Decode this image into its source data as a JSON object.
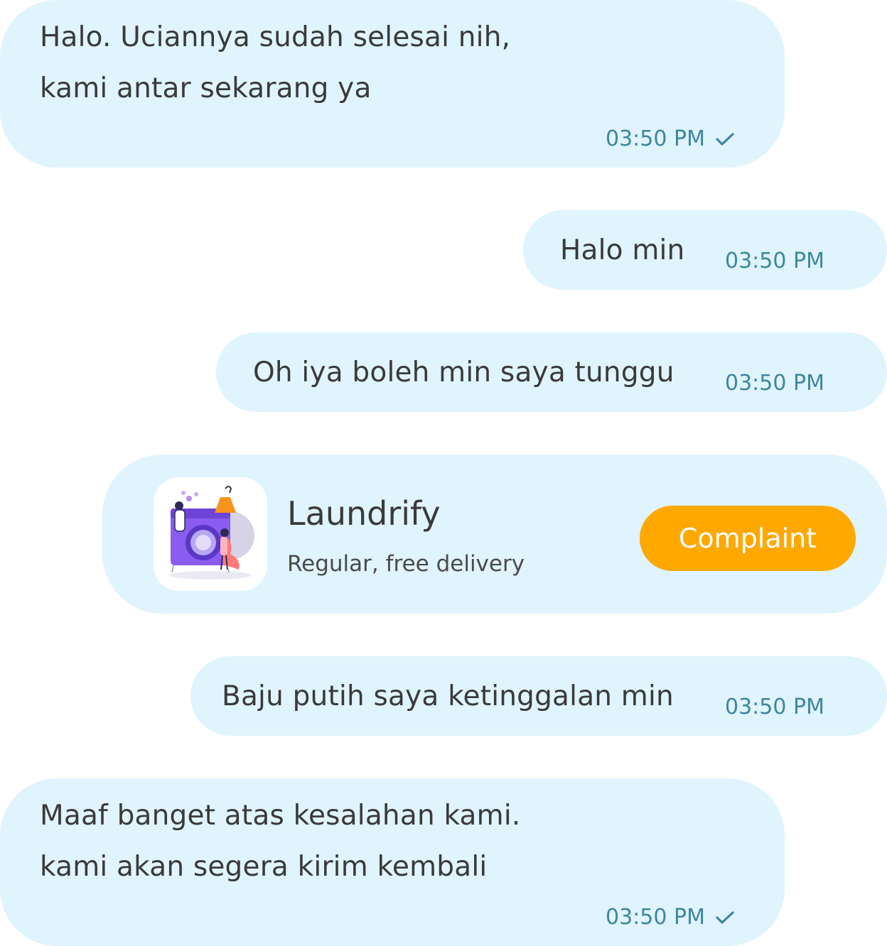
{
  "messages": [
    {
      "lines": [
        "Halo. Uciannya sudah selesai nih,",
        "kami antar sekarang ya"
      ],
      "time": "03:50 PM"
    },
    {
      "text": "Halo min",
      "time": "03:50 PM"
    },
    {
      "text": "Oh iya boleh min saya tunggu",
      "time": "03:50 PM"
    },
    {
      "text": "Baju putih saya ketinggalan min",
      "time": "03:50 PM"
    },
    {
      "lines": [
        "Maaf banget atas kesalahan kami.",
        "kami akan segera kirim kembali"
      ],
      "time": "03:50 PM"
    }
  ],
  "order_card": {
    "title": "Laundrify",
    "subtitle": "Regular, free delivery",
    "button_label": "Complaint",
    "illustration": "laundry-machine-illustration"
  },
  "icons": {
    "read": "check-icon"
  },
  "colors": {
    "bubble": "#e0f4fd",
    "time": "#3c879f",
    "accent": "#fea800",
    "text": "#3a3a3a"
  }
}
